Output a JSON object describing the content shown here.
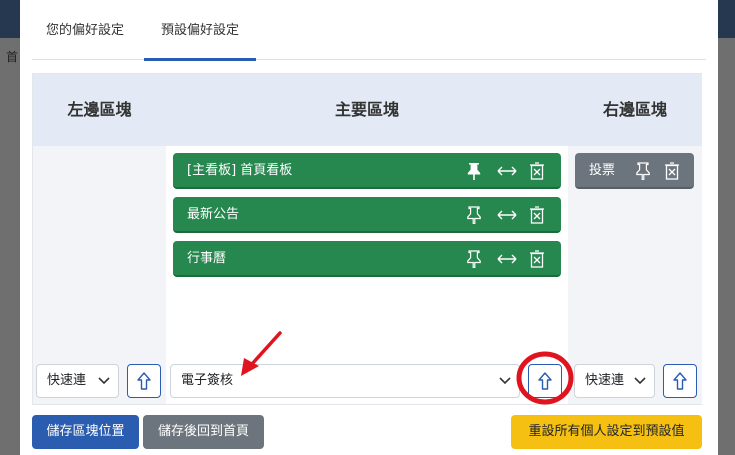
{
  "background": {
    "left_text": "首"
  },
  "tabs": [
    {
      "label": "您的偏好設定",
      "active": false
    },
    {
      "label": "預設偏好設定",
      "active": true
    }
  ],
  "columns": {
    "left": {
      "title": "左邊區塊"
    },
    "main": {
      "title": "主要區塊"
    },
    "right": {
      "title": "右邊區塊"
    }
  },
  "main_blocks": [
    {
      "label": "[主看板] 首頁看板",
      "pinned": true
    },
    {
      "label": "最新公告",
      "pinned": false
    },
    {
      "label": "行事曆",
      "pinned": false
    }
  ],
  "right_blocks": [
    {
      "label": "投票",
      "pinned": false
    }
  ],
  "selects": {
    "left": "快速連",
    "main": "電子簽核",
    "right": "快速連"
  },
  "buttons": {
    "save_position": "儲存區塊位置",
    "save_return": "儲存後回到首頁",
    "reset_all": "重設所有個人設定到預設值"
  },
  "colors": {
    "block_green": "#26874f",
    "block_gray": "#6c757d",
    "primary": "#2a5db0",
    "warning": "#f5c012",
    "annotation_red": "#e0141e"
  },
  "icons": {
    "pin": "pin-icon",
    "move": "move-horizontal-icon",
    "delete": "delete-icon",
    "up": "arrow-up-icon",
    "chevron": "chevron-down-icon"
  }
}
